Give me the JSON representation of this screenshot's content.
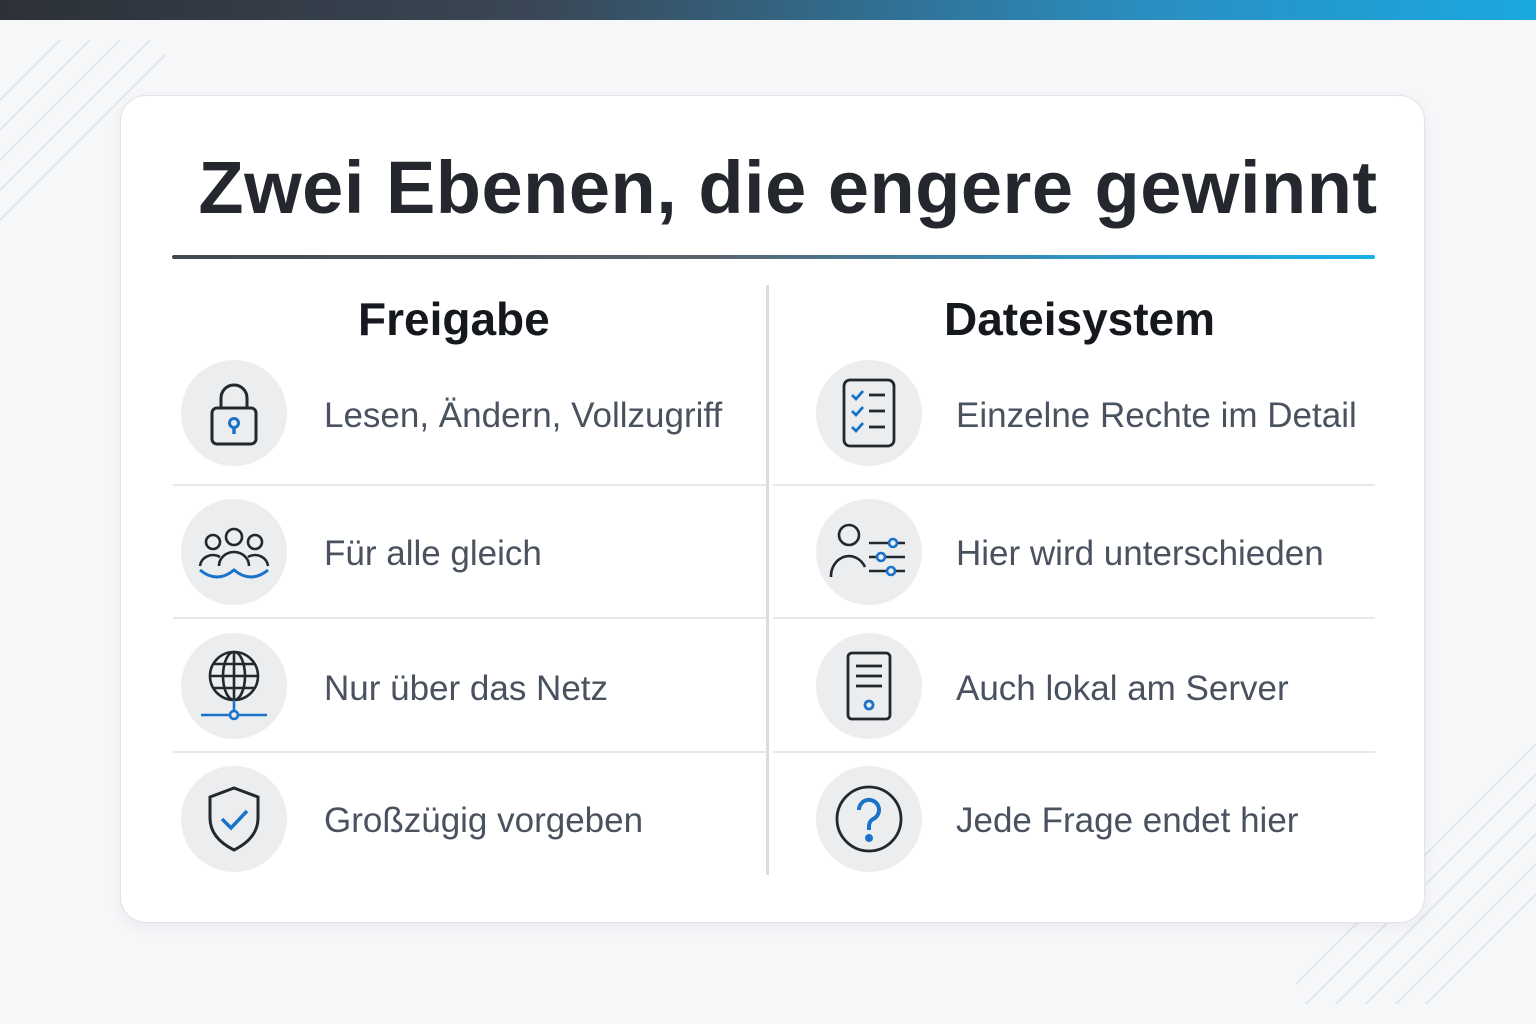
{
  "title": "Zwei Ebenen, die engere gewinnt",
  "columns": [
    {
      "heading": "Freigabe",
      "items": [
        {
          "icon": "lock-icon",
          "text": "Lesen, Ändern, Vollzugriff"
        },
        {
          "icon": "group-icon",
          "text": "Für alle gleich"
        },
        {
          "icon": "globe-network-icon",
          "text": "Nur über das Netz"
        },
        {
          "icon": "shield-check-icon",
          "text": "Großzügig vorgeben"
        }
      ]
    },
    {
      "heading": "Dateisystem",
      "items": [
        {
          "icon": "checklist-icon",
          "text": "Einzelne Rechte im Detail"
        },
        {
          "icon": "user-settings-icon",
          "text": "Hier wird unterschieden"
        },
        {
          "icon": "server-icon",
          "text": "Auch lokal am Server"
        },
        {
          "icon": "question-icon",
          "text": "Jede Frage endet hier"
        }
      ]
    }
  ],
  "colors": {
    "accent": "#1a73c8",
    "icon_stroke": "#23272e",
    "text": "#4a5260",
    "heading": "#15181d"
  }
}
